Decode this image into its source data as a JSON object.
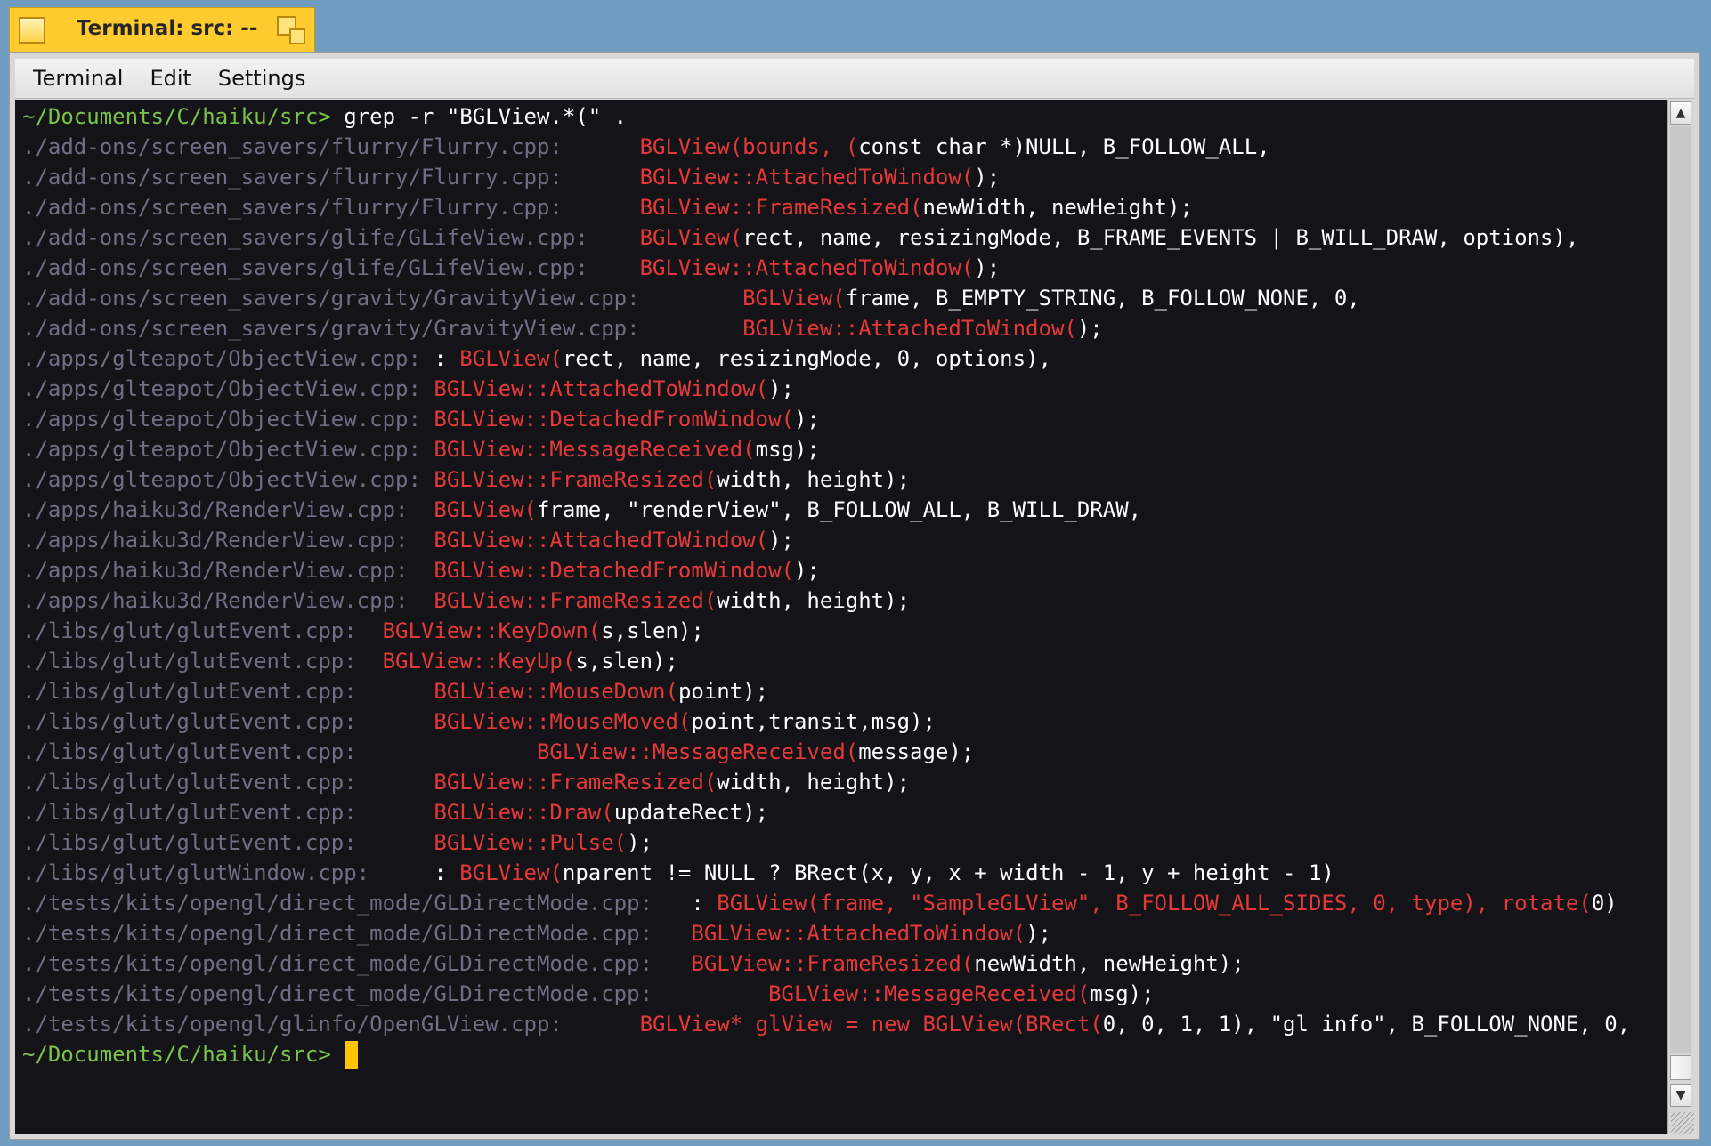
{
  "window": {
    "title": "Terminal: src: --"
  },
  "menu": {
    "items": [
      "Terminal",
      "Edit",
      "Settings"
    ]
  },
  "terminal": {
    "prompt": "~/Documents/C/haiku/src>",
    "command": "grep -r \"BGLView.*(\" .",
    "lines": [
      {
        "path": "./add-ons/screen_savers/flurry/Flurry.cpp:",
        "gap": "      ",
        "segs": [
          [
            "r",
            "BGLView(bounds, ("
          ],
          [
            "w",
            "const char *)NULL, B_FOLLOW_ALL,"
          ]
        ]
      },
      {
        "path": "./add-ons/screen_savers/flurry/Flurry.cpp:",
        "gap": "      ",
        "segs": [
          [
            "r",
            "BGLView::AttachedToWindow("
          ],
          [
            "w",
            ");"
          ]
        ]
      },
      {
        "path": "./add-ons/screen_savers/flurry/Flurry.cpp:",
        "gap": "      ",
        "segs": [
          [
            "r",
            "BGLView::FrameResized("
          ],
          [
            "w",
            "newWidth, newHeight);"
          ]
        ]
      },
      {
        "path": "./add-ons/screen_savers/glife/GLifeView.cpp:",
        "gap": "    ",
        "segs": [
          [
            "r",
            "BGLView("
          ],
          [
            "w",
            "rect, name, resizingMode, B_FRAME_EVENTS | B_WILL_DRAW, options),"
          ]
        ]
      },
      {
        "path": "./add-ons/screen_savers/glife/GLifeView.cpp:",
        "gap": "    ",
        "segs": [
          [
            "r",
            "BGLView::AttachedToWindow("
          ],
          [
            "w",
            ");"
          ]
        ]
      },
      {
        "path": "./add-ons/screen_savers/gravity/GravityView.cpp:",
        "gap": "        ",
        "segs": [
          [
            "r",
            "BGLView("
          ],
          [
            "w",
            "frame, B_EMPTY_STRING, B_FOLLOW_NONE, 0,"
          ]
        ]
      },
      {
        "path": "./add-ons/screen_savers/gravity/GravityView.cpp:",
        "gap": "        ",
        "segs": [
          [
            "r",
            "BGLView::AttachedToWindow("
          ],
          [
            "w",
            ");"
          ]
        ]
      },
      {
        "path": "./apps/glteapot/ObjectView.cpp:",
        "gap": " ",
        "segs": [
          [
            "w",
            ": "
          ],
          [
            "r",
            "BGLView("
          ],
          [
            "w",
            "rect, name, resizingMode, 0, options),"
          ]
        ]
      },
      {
        "path": "./apps/glteapot/ObjectView.cpp:",
        "gap": " ",
        "segs": [
          [
            "r",
            "BGLView::AttachedToWindow("
          ],
          [
            "w",
            ");"
          ]
        ]
      },
      {
        "path": "./apps/glteapot/ObjectView.cpp:",
        "gap": " ",
        "segs": [
          [
            "r",
            "BGLView::DetachedFromWindow("
          ],
          [
            "w",
            ");"
          ]
        ]
      },
      {
        "path": "./apps/glteapot/ObjectView.cpp:",
        "gap": " ",
        "segs": [
          [
            "r",
            "BGLView::MessageReceived("
          ],
          [
            "w",
            "msg);"
          ]
        ]
      },
      {
        "path": "./apps/glteapot/ObjectView.cpp:",
        "gap": " ",
        "segs": [
          [
            "r",
            "BGLView::FrameResized("
          ],
          [
            "w",
            "width, height);"
          ]
        ]
      },
      {
        "path": "./apps/haiku3d/RenderView.cpp:",
        "gap": "  ",
        "segs": [
          [
            "r",
            "BGLView("
          ],
          [
            "w",
            "frame, \"renderView\", B_FOLLOW_ALL, B_WILL_DRAW,"
          ]
        ]
      },
      {
        "path": "./apps/haiku3d/RenderView.cpp:",
        "gap": "  ",
        "segs": [
          [
            "r",
            "BGLView::AttachedToWindow("
          ],
          [
            "w",
            ");"
          ]
        ]
      },
      {
        "path": "./apps/haiku3d/RenderView.cpp:",
        "gap": "  ",
        "segs": [
          [
            "r",
            "BGLView::DetachedFromWindow("
          ],
          [
            "w",
            ");"
          ]
        ]
      },
      {
        "path": "./apps/haiku3d/RenderView.cpp:",
        "gap": "  ",
        "segs": [
          [
            "r",
            "BGLView::FrameResized("
          ],
          [
            "w",
            "width, height);"
          ]
        ]
      },
      {
        "path": "./libs/glut/glutEvent.cpp:",
        "gap": "  ",
        "segs": [
          [
            "r",
            "BGLView::KeyDown("
          ],
          [
            "w",
            "s,slen);"
          ]
        ]
      },
      {
        "path": "./libs/glut/glutEvent.cpp:",
        "gap": "  ",
        "segs": [
          [
            "r",
            "BGLView::KeyUp("
          ],
          [
            "w",
            "s,slen);"
          ]
        ]
      },
      {
        "path": "./libs/glut/glutEvent.cpp:",
        "gap": "      ",
        "segs": [
          [
            "r",
            "BGLView::MouseDown("
          ],
          [
            "w",
            "point);"
          ]
        ]
      },
      {
        "path": "./libs/glut/glutEvent.cpp:",
        "gap": "      ",
        "segs": [
          [
            "r",
            "BGLView::MouseMoved("
          ],
          [
            "w",
            "point,transit,msg);"
          ]
        ]
      },
      {
        "path": "./libs/glut/glutEvent.cpp:",
        "gap": "              ",
        "segs": [
          [
            "r",
            "BGLView::MessageReceived("
          ],
          [
            "w",
            "message);"
          ]
        ]
      },
      {
        "path": "./libs/glut/glutEvent.cpp:",
        "gap": "      ",
        "segs": [
          [
            "r",
            "BGLView::FrameResized("
          ],
          [
            "w",
            "width, height);"
          ]
        ]
      },
      {
        "path": "./libs/glut/glutEvent.cpp:",
        "gap": "      ",
        "segs": [
          [
            "r",
            "BGLView::Draw("
          ],
          [
            "w",
            "updateRect);"
          ]
        ]
      },
      {
        "path": "./libs/glut/glutEvent.cpp:",
        "gap": "      ",
        "segs": [
          [
            "r",
            "BGLView::Pulse("
          ],
          [
            "w",
            ");"
          ]
        ]
      },
      {
        "path": "./libs/glut/glutWindow.cpp:",
        "gap": "     ",
        "segs": [
          [
            "w",
            ": "
          ],
          [
            "r",
            "BGLView("
          ],
          [
            "w",
            "nparent != NULL ? BRect(x, y, x + width - 1, y + height - 1)"
          ]
        ]
      },
      {
        "path": "./tests/kits/opengl/direct_mode/GLDirectMode.cpp:",
        "gap": "   ",
        "segs": [
          [
            "w",
            ": "
          ],
          [
            "r",
            "BGLView(frame, \"SampleGLView\", B_FOLLOW_ALL_SIDES, 0, type), rotate("
          ],
          [
            "w",
            "0)"
          ]
        ]
      },
      {
        "path": "./tests/kits/opengl/direct_mode/GLDirectMode.cpp:",
        "gap": "   ",
        "segs": [
          [
            "r",
            "BGLView::AttachedToWindow("
          ],
          [
            "w",
            ");"
          ]
        ]
      },
      {
        "path": "./tests/kits/opengl/direct_mode/GLDirectMode.cpp:",
        "gap": "   ",
        "segs": [
          [
            "r",
            "BGLView::FrameResized("
          ],
          [
            "w",
            "newWidth, newHeight);"
          ]
        ]
      },
      {
        "path": "./tests/kits/opengl/direct_mode/GLDirectMode.cpp:",
        "gap": "         ",
        "segs": [
          [
            "r",
            "BGLView::MessageReceived("
          ],
          [
            "w",
            "msg);"
          ]
        ]
      },
      {
        "path": "./tests/kits/opengl/glinfo/OpenGLView.cpp:",
        "gap": "      ",
        "segs": [
          [
            "r",
            "BGLView* glView = new BGLView(BRect("
          ],
          [
            "w",
            "0, 0, 1, 1), \"gl info\", B_FOLLOW_NONE, 0,"
          ]
        ]
      }
    ]
  },
  "colors": {
    "prompt": "#7bc24a",
    "path": "#6e6e84",
    "match": "#e53838",
    "text": "#ffffff",
    "cursor": "#ffc400",
    "tab": "#ffcb2e",
    "background": "#141418"
  },
  "icons": {
    "close": "close-box-icon",
    "zoom": "zoom-icon",
    "up": "up-arrow-icon",
    "down": "down-arrow-icon"
  }
}
